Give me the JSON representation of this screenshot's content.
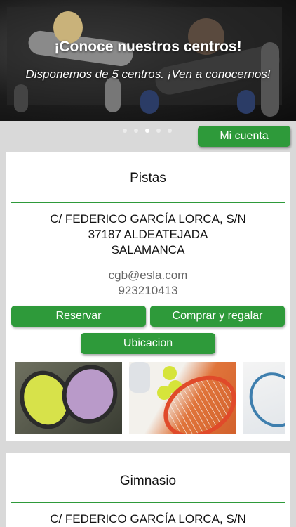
{
  "hero": {
    "title": "¡Conoce nuestros centros!",
    "subtitle": "Disponemos de 5 centros. ¡Ven a conocernos!",
    "slide_count": 5,
    "active_slide": 3
  },
  "account_button": "Mi cuenta",
  "colors": {
    "accent": "#2e9a3a",
    "background": "#d9d9d9",
    "card": "#ffffff"
  },
  "centers": [
    {
      "title": "Pistas",
      "address": [
        "C/ FEDERICO GARCÍA LORCA, S/N",
        "37187 ALDEATEJADA",
        "SALAMANCA"
      ],
      "email": "cgb@esla.com",
      "phone": "923210413",
      "buttons": {
        "reserve": "Reservar",
        "buy": "Comprar y regalar",
        "location": "Ubicacion"
      },
      "photos": [
        "padel-rackets-photo",
        "tennis-racket-balls-photo",
        "racket-photo"
      ]
    },
    {
      "title": "Gimnasio",
      "address": [
        "C/ FEDERICO GARCÍA LORCA, S/N"
      ]
    }
  ]
}
